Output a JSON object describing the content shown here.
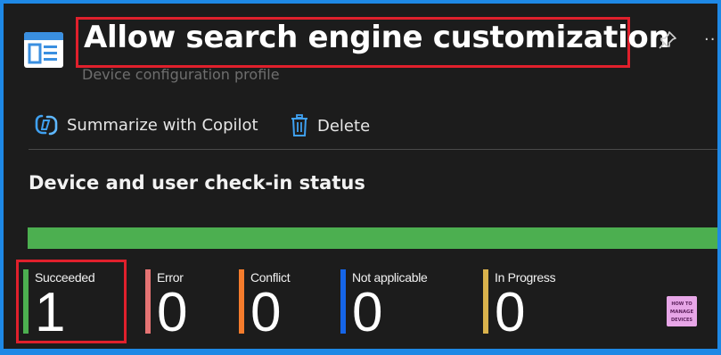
{
  "header": {
    "title": "Allow search engine customization",
    "subtitle": "Device configuration profile",
    "more_label": "···"
  },
  "toolbar": {
    "copilot_label": "Summarize with Copilot",
    "delete_label": "Delete"
  },
  "section": {
    "title": "Device and user check-in status"
  },
  "progress": {
    "succeeded_fraction": 1.0
  },
  "stats": [
    {
      "label": "Succeeded",
      "value": "1",
      "color": "#4caf50"
    },
    {
      "label": "Error",
      "value": "0",
      "color": "#e57373"
    },
    {
      "label": "Conflict",
      "value": "0",
      "color": "#f57c2c"
    },
    {
      "label": "Not applicable",
      "value": "0",
      "color": "#1565e8"
    },
    {
      "label": "In Progress",
      "value": "0",
      "color": "#d9b24c"
    }
  ],
  "watermark": {
    "lines": [
      "HOW TO",
      "MANAGE",
      "DEVICES"
    ]
  },
  "colors": {
    "accent_frame": "#1e88e5",
    "highlight": "#e0202c"
  }
}
